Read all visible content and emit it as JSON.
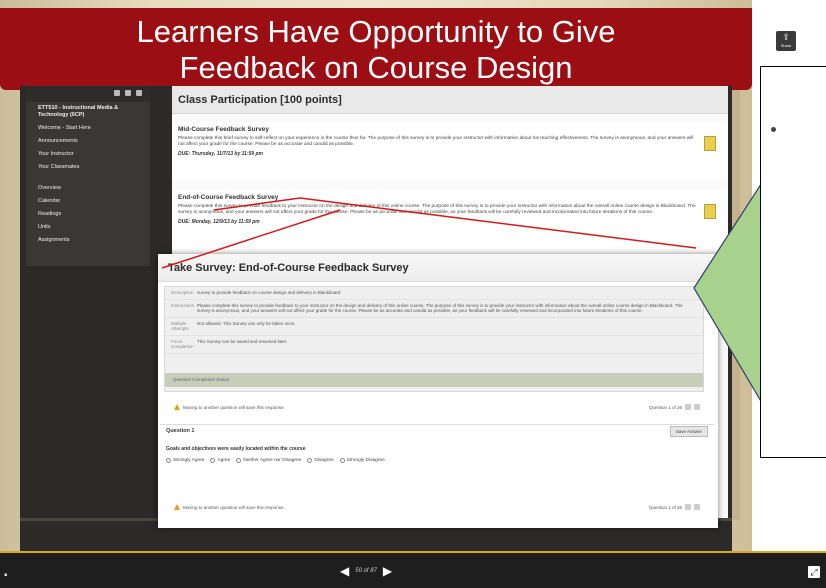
{
  "slide": {
    "title_line1": "Learners Have Opportunity to Give",
    "title_line2": "Feedback on Course Design"
  },
  "sidebar": {
    "items": [
      {
        "label": "ETT510 - Instructional Media & Technology (6CP)"
      },
      {
        "label": "Welcome - Start Here"
      },
      {
        "label": "Announcements"
      },
      {
        "label": "Your Instructor"
      },
      {
        "label": "Your Classmates"
      },
      {
        "label": "Overview"
      },
      {
        "label": "Calendar"
      },
      {
        "label": "Readings"
      },
      {
        "label": "Units"
      },
      {
        "label": "Assignments"
      }
    ]
  },
  "content": {
    "header": "Class Participation [100 points]",
    "surveys": [
      {
        "title": "Mid-Course Feedback Survey",
        "description": "Please complete this brief survey to self-reflect on your experience in the course thus far. The purpose of this survey is to provide your instructor with information about his teaching effectiveness. The survey is anonymous, and your answers will not affect your grade for the course. Please be as accurate and candid as possible.",
        "due": "DUE: Thursday, 11/7/13 by 11:59 pm"
      },
      {
        "title": "End-of-Course Feedback Survey",
        "description": "Please complete this survey to provide feedback to your instructor on the design and delivery of this online course. The purpose of this survey is to provide your instructor with information about the overall online course design in Blackboard. The survey is anonymous, and your answers will not affect your grade for the course. Please be as accurate and candid as possible, as your feedback will be carefully reviewed and incorporated into future iterations of this course.",
        "due": "DUE: Monday, 12/9/13 by 11:59 pm"
      }
    ]
  },
  "popup": {
    "title": "Take Survey: End-of-Course Feedback Survey",
    "rows": [
      {
        "key": "Description",
        "value": "survey to provide feedback on course design and delivery in Blackboard"
      },
      {
        "key": "Instructions",
        "value": "Please complete this survey to provide feedback to your instructor on the design and delivery of this online course. The purpose of this survey is to provide your instructor with information about the overall online course design in Blackboard. The survey is anonymous, and your answers will not affect your grade for the course. Please be as accurate and candid as possible, as your feedback will be carefully reviewed and incorporated into future iterations of this course."
      },
      {
        "key": "Multiple Attempts",
        "value": "Not allowed. This Survey can only be taken once."
      },
      {
        "key": "Force Completion",
        "value": "This Survey can be saved and resumed later."
      }
    ],
    "status": "Question Completion Status:",
    "warning": "Moving to another question will save this response.",
    "question_count": "Question 1 of 26",
    "question_heading": "Question 1",
    "save_answer": "Save Answer",
    "question_text": "Goals and objectives were easily located within the course",
    "options": [
      "Strongly Agree",
      "Agree",
      "Neither Agree nor Disagree",
      "Disagree",
      "Strongly Disagree"
    ]
  },
  "share": {
    "label": "Share"
  },
  "player": {
    "counter": "50 of 87"
  },
  "colors": {
    "banner": "#9b0f14",
    "arrow_fill": "#a9d18e",
    "annotation_line": "#d11a1a",
    "player_accent": "#d9a820"
  }
}
